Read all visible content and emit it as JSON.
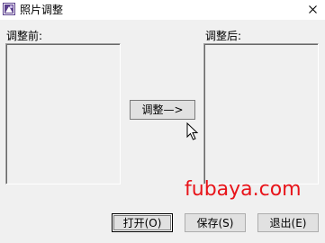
{
  "window": {
    "title": "照片调整",
    "app_icon": "photo-app-icon",
    "close_icon": "close-icon"
  },
  "labels": {
    "before": "调整前:",
    "after": "调整后:"
  },
  "buttons": {
    "adjust": "调整—>",
    "open": "打开(O)",
    "save": "保存(S)",
    "exit": "退出(E)"
  },
  "watermark": "fubaya.com",
  "colors": {
    "background": "#f0f0f0",
    "titlebar": "#ffffff",
    "watermark": "#e8141a",
    "icon_accent": "#5a3e8c"
  }
}
